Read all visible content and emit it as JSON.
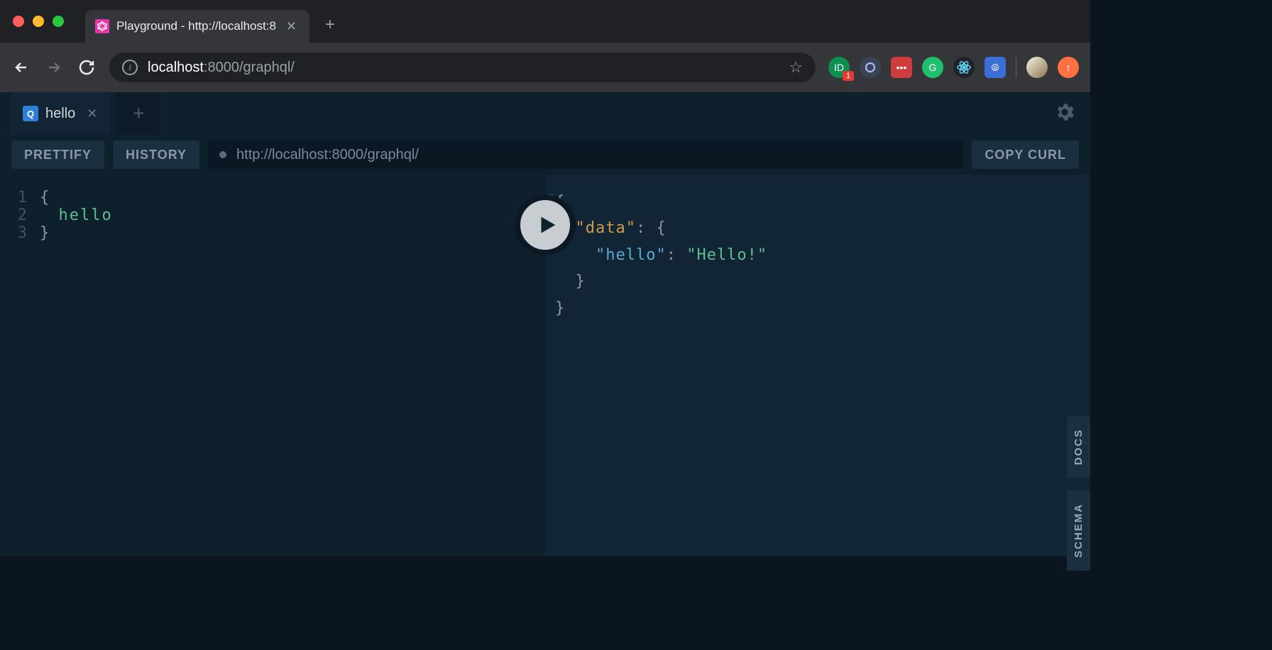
{
  "browser": {
    "tab_title": "Playground - http://localhost:8",
    "url_host": "localhost",
    "url_port_path": ":8000/graphql/",
    "extensions": {
      "badge_count": "1"
    }
  },
  "playground": {
    "tab": {
      "icon_letter": "Q",
      "label": "hello"
    },
    "toolbar": {
      "prettify": "PRETTIFY",
      "history": "HISTORY",
      "copy_curl": "COPY CURL",
      "endpoint": "http://localhost:8000/graphql/"
    },
    "editor": {
      "lines": [
        "1",
        "2",
        "3"
      ],
      "brace_open": "{",
      "field": "hello",
      "brace_close": "}"
    },
    "response": {
      "brace_open": "{",
      "data_key": "\"data\"",
      "colon_brace": ": {",
      "hello_key": "\"hello\"",
      "colon": ": ",
      "hello_val": "\"Hello!\"",
      "brace_close_inner": "}",
      "brace_close_outer": "}"
    },
    "rails": {
      "docs": "DOCS",
      "schema": "SCHEMA"
    }
  }
}
